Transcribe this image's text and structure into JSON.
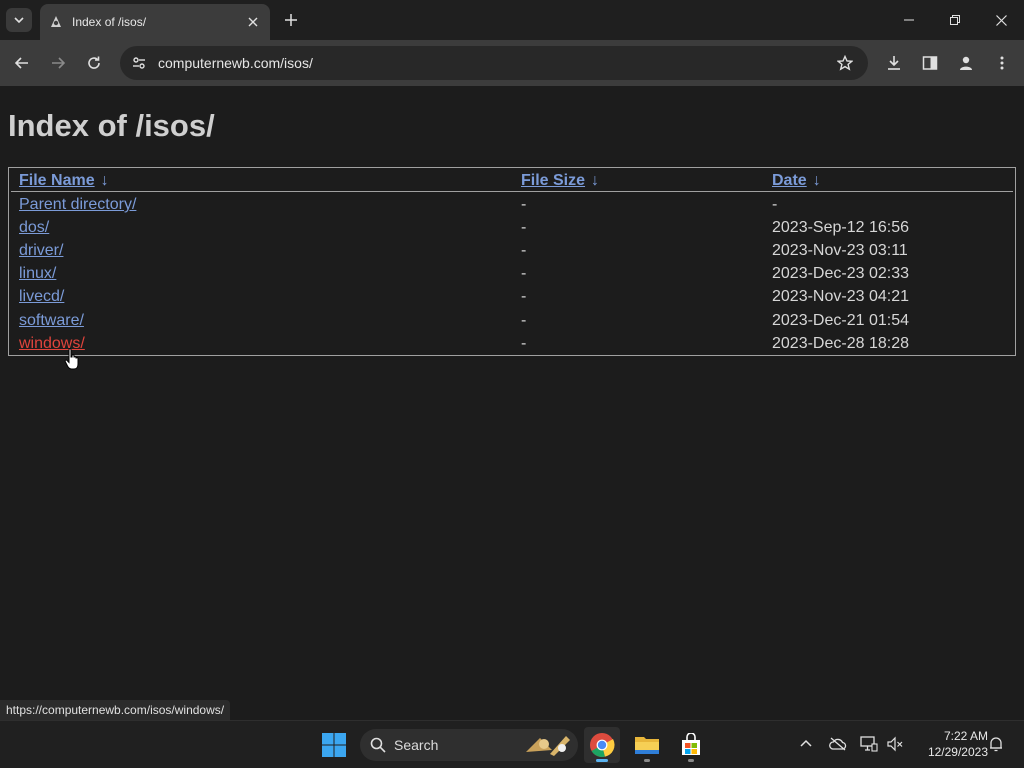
{
  "tab": {
    "title": "Index of /isos/"
  },
  "toolbar": {
    "url": "computernewb.com/isos/"
  },
  "page": {
    "heading": "Index of /isos/",
    "columns": {
      "name": "File Name",
      "size": "File Size",
      "date": "Date",
      "sort_arrow": "↓"
    },
    "rows": [
      {
        "name": "Parent directory/",
        "size": "-",
        "date": "-"
      },
      {
        "name": "dos/",
        "size": "-",
        "date": "2023-Sep-12 16:56"
      },
      {
        "name": "driver/",
        "size": "-",
        "date": "2023-Nov-23 03:11"
      },
      {
        "name": "linux/",
        "size": "-",
        "date": "2023-Dec-23 02:33"
      },
      {
        "name": "livecd/",
        "size": "-",
        "date": "2023-Nov-23 04:21"
      },
      {
        "name": "software/",
        "size": "-",
        "date": "2023-Dec-21 01:54"
      },
      {
        "name": "windows/",
        "size": "-",
        "date": "2023-Dec-28 18:28"
      }
    ]
  },
  "status_bar": {
    "hover_url": "https://computernewb.com/isos/windows/"
  },
  "taskbar": {
    "search_label": "Search",
    "time": "7:22 AM",
    "date": "12/29/2023"
  },
  "colors": {
    "link": "#7b9bd8",
    "link_active": "#e0443c",
    "background": "#1c1c1c"
  }
}
